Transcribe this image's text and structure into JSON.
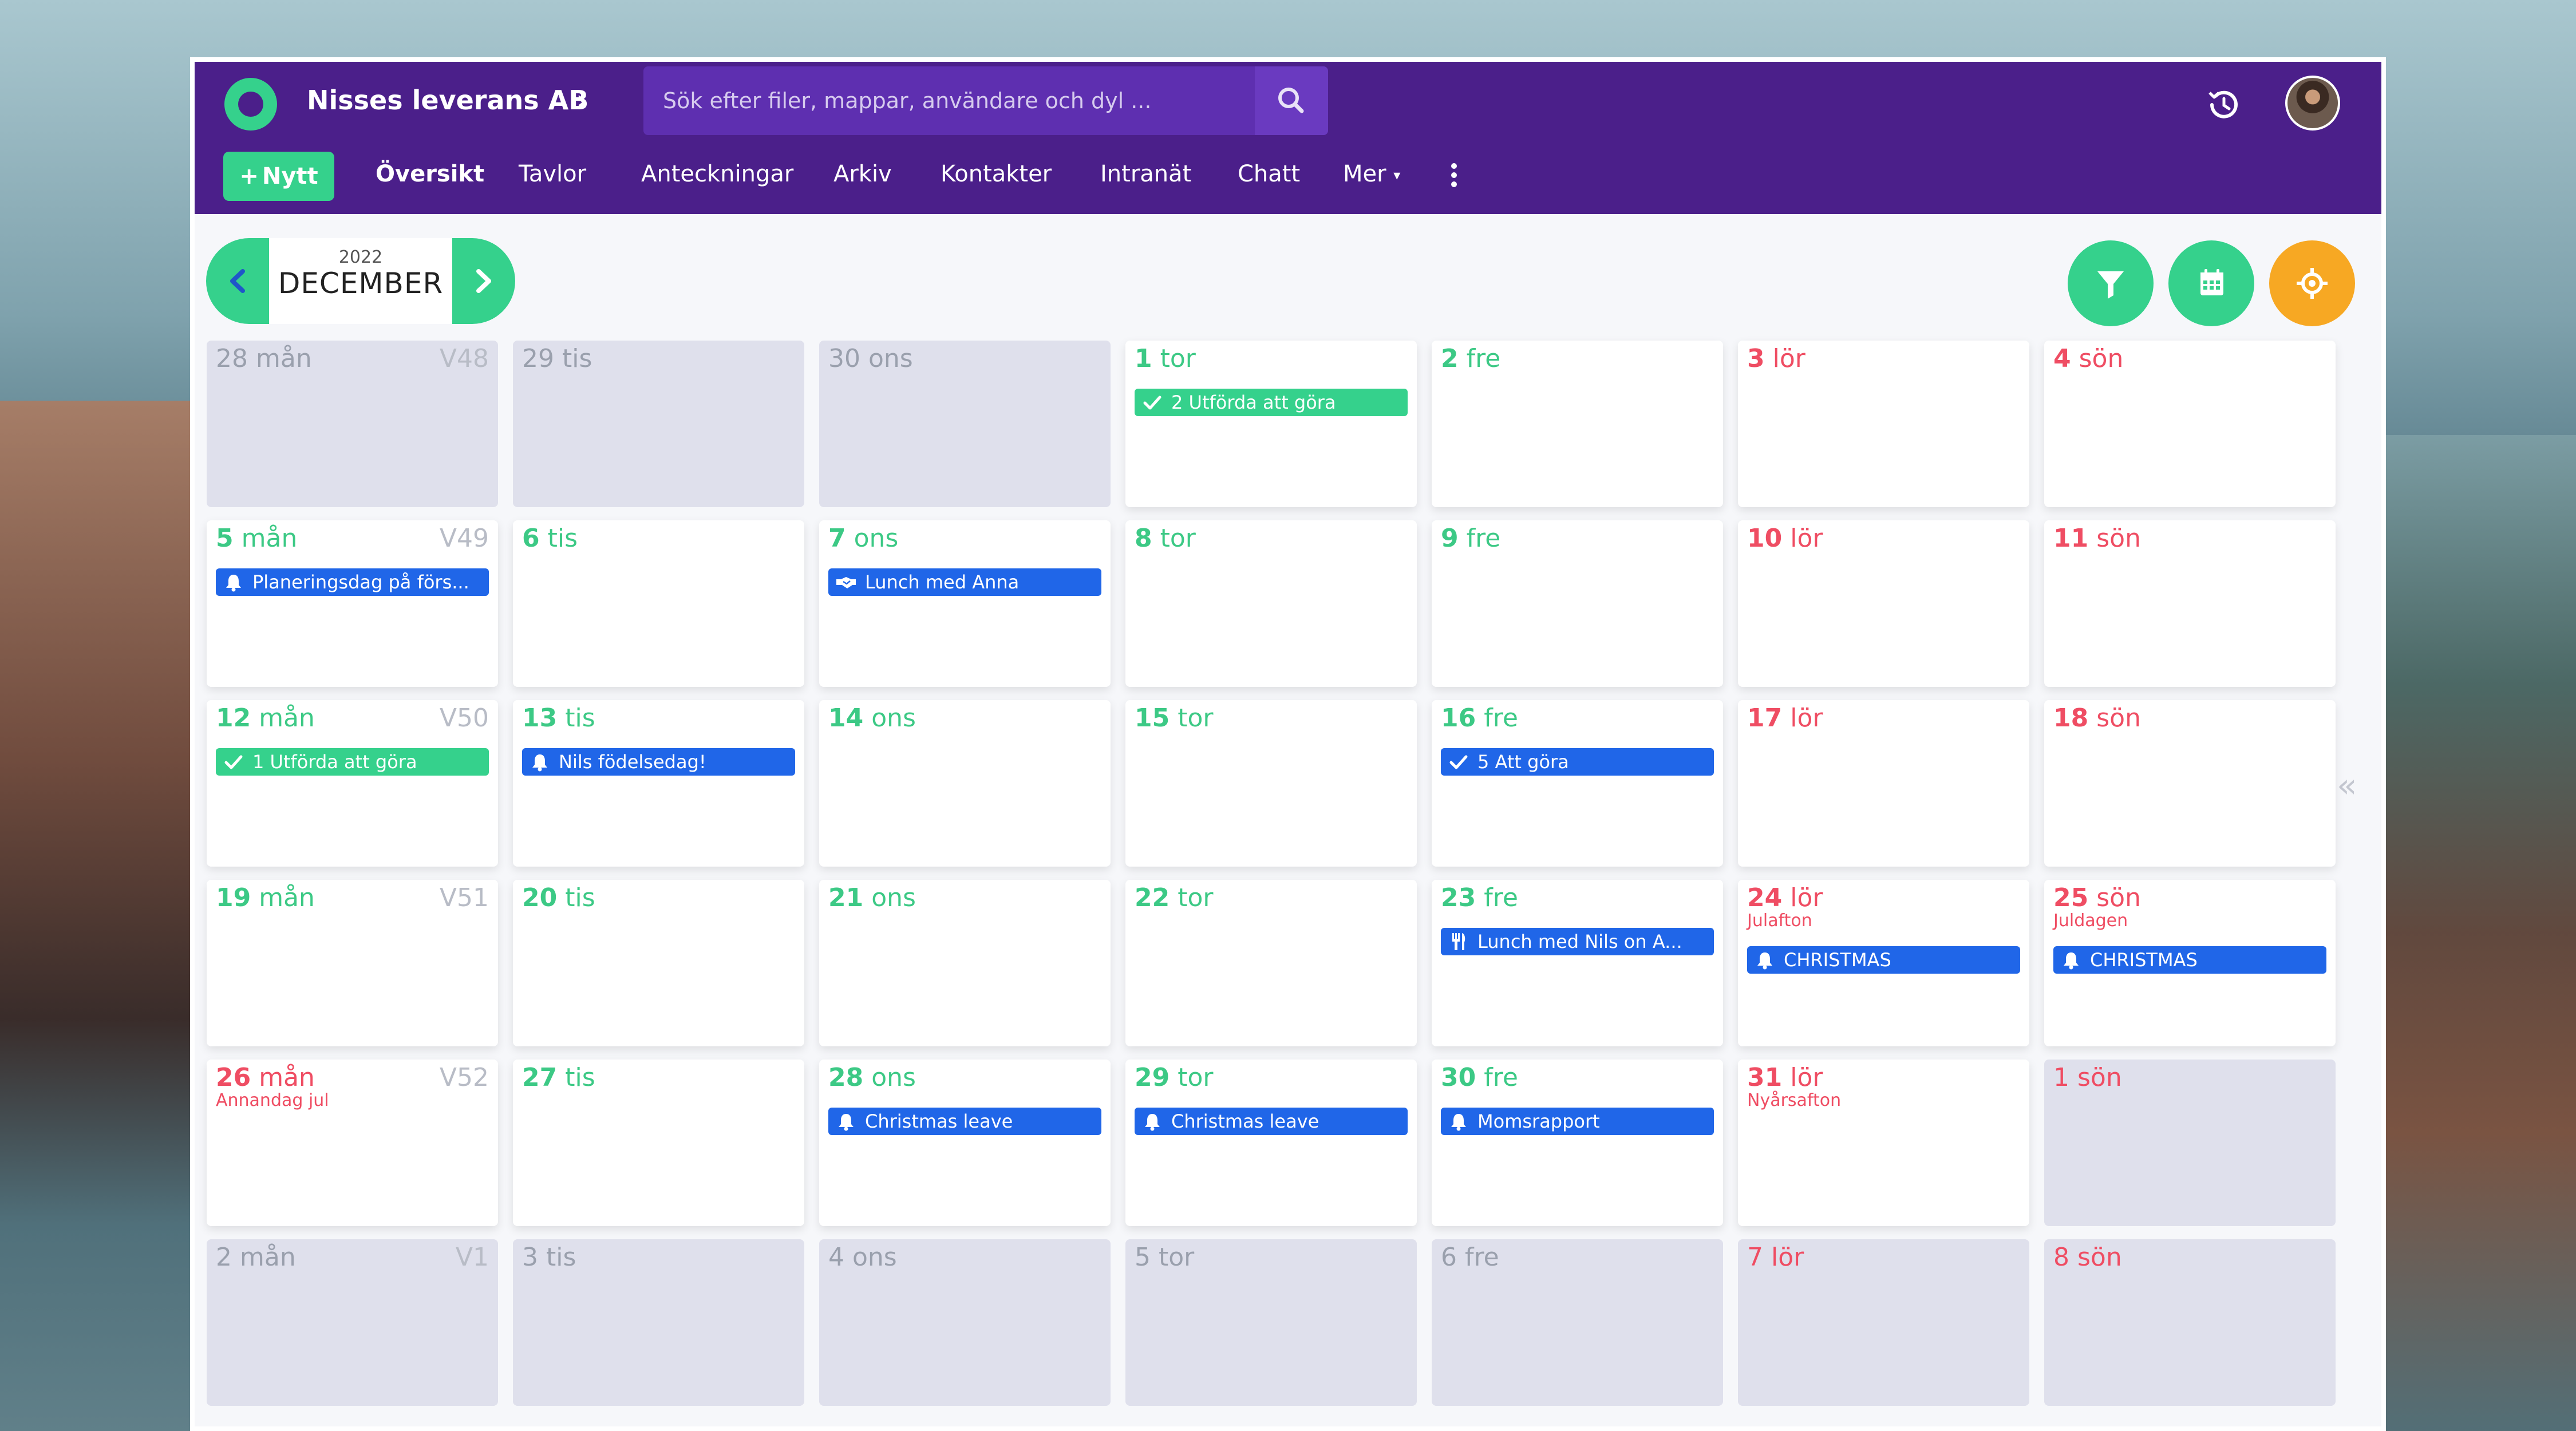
{
  "app": {
    "company": "Nisses leverans AB",
    "search_placeholder": "Sök efter filer, mappar, användare och dyl ...",
    "new_button": "Nytt",
    "nav": [
      "Översikt",
      "Tavlor",
      "Anteckningar",
      "Arkiv",
      "Kontakter",
      "Intranät",
      "Chatt",
      "Mer"
    ],
    "active_nav": "Översikt"
  },
  "calendar": {
    "year": "2022",
    "month": "DECEMBER",
    "weeks": [
      {
        "week": "V48",
        "days": [
          {
            "num": "28",
            "wd": "mån",
            "outside": true
          },
          {
            "num": "29",
            "wd": "tis",
            "outside": true
          },
          {
            "num": "30",
            "wd": "ons",
            "outside": true
          },
          {
            "num": "1",
            "wd": "tor",
            "events": [
              {
                "icon": "check-icon",
                "color": "green",
                "label": "2 Utförda att göra"
              }
            ]
          },
          {
            "num": "2",
            "wd": "fre"
          },
          {
            "num": "3",
            "wd": "lör",
            "weekend": true
          },
          {
            "num": "4",
            "wd": "sön",
            "weekend": true
          }
        ]
      },
      {
        "week": "V49",
        "days": [
          {
            "num": "5",
            "wd": "mån",
            "events": [
              {
                "icon": "bell-icon",
                "color": "blue",
                "label": "Planeringsdag på förs..."
              }
            ]
          },
          {
            "num": "6",
            "wd": "tis"
          },
          {
            "num": "7",
            "wd": "ons",
            "events": [
              {
                "icon": "handshake-icon",
                "color": "blue",
                "label": "Lunch med Anna"
              }
            ]
          },
          {
            "num": "8",
            "wd": "tor"
          },
          {
            "num": "9",
            "wd": "fre"
          },
          {
            "num": "10",
            "wd": "lör",
            "weekend": true
          },
          {
            "num": "11",
            "wd": "sön",
            "weekend": true
          }
        ]
      },
      {
        "week": "V50",
        "days": [
          {
            "num": "12",
            "wd": "mån",
            "events": [
              {
                "icon": "check-icon",
                "color": "green",
                "label": "1 Utförda att göra"
              }
            ]
          },
          {
            "num": "13",
            "wd": "tis",
            "events": [
              {
                "icon": "bell-icon",
                "color": "blue",
                "label": "Nils födelsedag!"
              }
            ]
          },
          {
            "num": "14",
            "wd": "ons"
          },
          {
            "num": "15",
            "wd": "tor"
          },
          {
            "num": "16",
            "wd": "fre",
            "events": [
              {
                "icon": "check-icon",
                "color": "blue",
                "label": "5 Att göra"
              }
            ]
          },
          {
            "num": "17",
            "wd": "lör",
            "weekend": true
          },
          {
            "num": "18",
            "wd": "sön",
            "weekend": true
          }
        ]
      },
      {
        "week": "V51",
        "days": [
          {
            "num": "19",
            "wd": "mån"
          },
          {
            "num": "20",
            "wd": "tis"
          },
          {
            "num": "21",
            "wd": "ons"
          },
          {
            "num": "22",
            "wd": "tor"
          },
          {
            "num": "23",
            "wd": "fre",
            "events": [
              {
                "icon": "fork-knife-icon",
                "color": "blue",
                "label": "Lunch med Nils on A..."
              }
            ]
          },
          {
            "num": "24",
            "wd": "lör",
            "weekend": true,
            "holiday": "Julafton",
            "events": [
              {
                "icon": "bell-icon",
                "color": "blue",
                "label": "CHRISTMAS"
              }
            ]
          },
          {
            "num": "25",
            "wd": "sön",
            "weekend": true,
            "holiday": "Juldagen",
            "events": [
              {
                "icon": "bell-icon",
                "color": "blue",
                "label": "CHRISTMAS"
              }
            ]
          }
        ]
      },
      {
        "week": "V52",
        "days": [
          {
            "num": "26",
            "wd": "mån",
            "weekend": true,
            "holiday": "Annandag jul"
          },
          {
            "num": "27",
            "wd": "tis"
          },
          {
            "num": "28",
            "wd": "ons",
            "events": [
              {
                "icon": "bell-icon",
                "color": "blue",
                "label": "Christmas leave"
              }
            ]
          },
          {
            "num": "29",
            "wd": "tor",
            "events": [
              {
                "icon": "bell-icon",
                "color": "blue",
                "label": "Christmas leave"
              }
            ]
          },
          {
            "num": "30",
            "wd": "fre",
            "events": [
              {
                "icon": "bell-icon",
                "color": "blue",
                "label": "Momsrapport"
              }
            ]
          },
          {
            "num": "31",
            "wd": "lör",
            "weekend": true,
            "holiday": "Nyårsafton"
          },
          {
            "num": "1",
            "wd": "sön",
            "weekend": true,
            "outside": true
          }
        ]
      },
      {
        "week": "V1",
        "days": [
          {
            "num": "2",
            "wd": "mån",
            "outside": true
          },
          {
            "num": "3",
            "wd": "tis",
            "outside": true
          },
          {
            "num": "4",
            "wd": "ons",
            "outside": true
          },
          {
            "num": "5",
            "wd": "tor",
            "outside": true
          },
          {
            "num": "6",
            "wd": "fre",
            "outside": true
          },
          {
            "num": "7",
            "wd": "lör",
            "weekend": true,
            "outside": true
          },
          {
            "num": "8",
            "wd": "sön",
            "weekend": true,
            "outside": true
          }
        ]
      }
    ]
  },
  "colors": {
    "purple": "#4b1f8a",
    "green": "#35d18c",
    "blue": "#2066e8",
    "red": "#ef4d63",
    "orange": "#f7a823"
  },
  "icons": {
    "prev": "chevron-left-icon",
    "next": "chevron-right-icon",
    "filter": "filter-icon",
    "calendar": "calendar-icon",
    "target": "crosshair-icon",
    "search": "search-icon",
    "history": "history-icon",
    "collapse": "double-chevron-left-icon"
  }
}
